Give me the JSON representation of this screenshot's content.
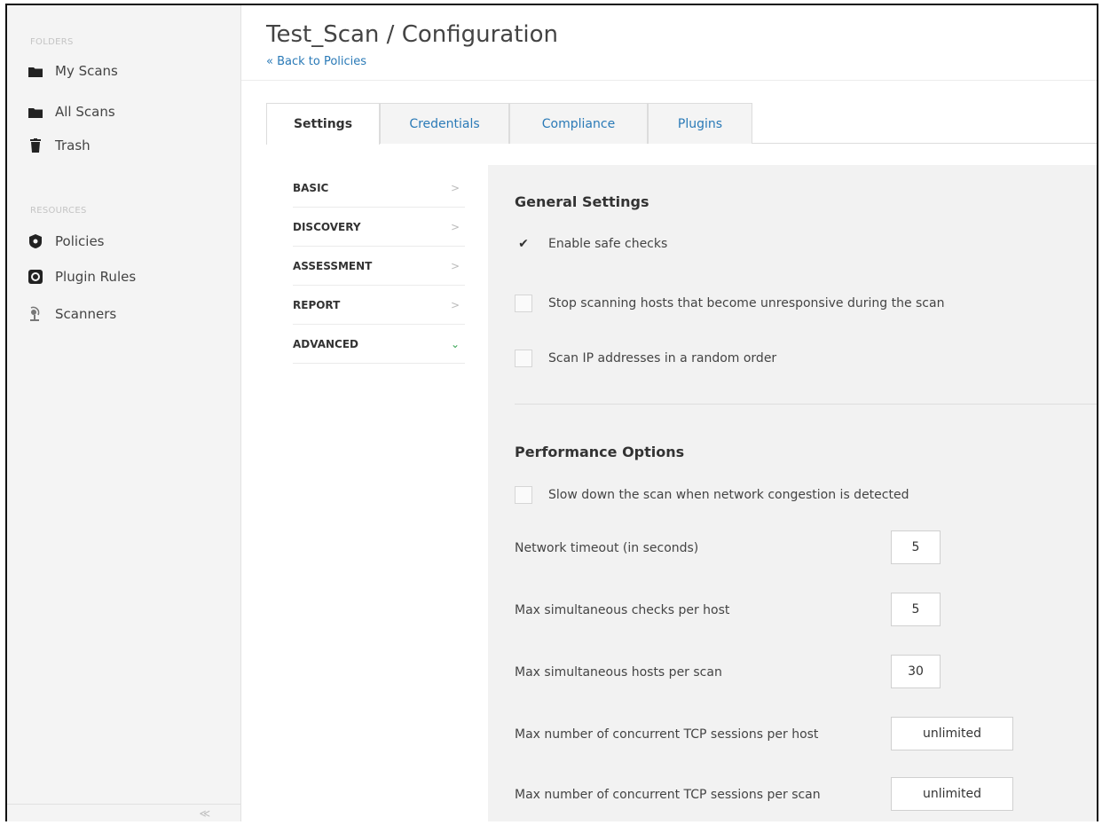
{
  "sidebar": {
    "folders_label": "FOLDERS",
    "folders": [
      {
        "label": "My Scans",
        "icon": "folder-icon"
      },
      {
        "label": "All Scans",
        "icon": "folder-icon"
      },
      {
        "label": "Trash",
        "icon": "trash-icon"
      }
    ],
    "resources_label": "RESOURCES",
    "resources": [
      {
        "label": "Policies",
        "icon": "shield-icon"
      },
      {
        "label": "Plugin Rules",
        "icon": "plugin-rules-icon"
      },
      {
        "label": "Scanners",
        "icon": "scanner-icon"
      }
    ]
  },
  "header": {
    "title": "Test_Scan / Configuration",
    "back_link": "« Back to Policies"
  },
  "tabs": [
    {
      "label": "Settings",
      "active": true
    },
    {
      "label": "Credentials",
      "active": false
    },
    {
      "label": "Compliance",
      "active": false
    },
    {
      "label": "Plugins",
      "active": false
    }
  ],
  "settings_nav": [
    {
      "label": "BASIC",
      "chevron": ">"
    },
    {
      "label": "DISCOVERY",
      "chevron": ">"
    },
    {
      "label": "ASSESSMENT",
      "chevron": ">"
    },
    {
      "label": "REPORT",
      "chevron": ">"
    },
    {
      "label": "ADVANCED",
      "chevron": "⌄"
    }
  ],
  "general": {
    "title": "General Settings",
    "options": [
      {
        "label": "Enable safe checks",
        "checked": true
      },
      {
        "label": "Stop scanning hosts that become unresponsive during the scan",
        "checked": false
      },
      {
        "label": "Scan IP addresses in a random order",
        "checked": false
      }
    ]
  },
  "performance": {
    "title": "Performance Options",
    "option": {
      "label": "Slow down the scan when network congestion is detected",
      "checked": false
    },
    "fields": [
      {
        "label": "Network timeout (in seconds)",
        "value": "5"
      },
      {
        "label": "Max simultaneous checks per host",
        "value": "5"
      },
      {
        "label": "Max simultaneous hosts per scan",
        "value": "30"
      },
      {
        "label": "Max number of concurrent TCP sessions per host",
        "value": "unlimited"
      },
      {
        "label": "Max number of concurrent TCP sessions per scan",
        "value": "unlimited"
      }
    ]
  },
  "colors": {
    "link": "#2a7ab7",
    "accent_green": "#3aa655"
  }
}
